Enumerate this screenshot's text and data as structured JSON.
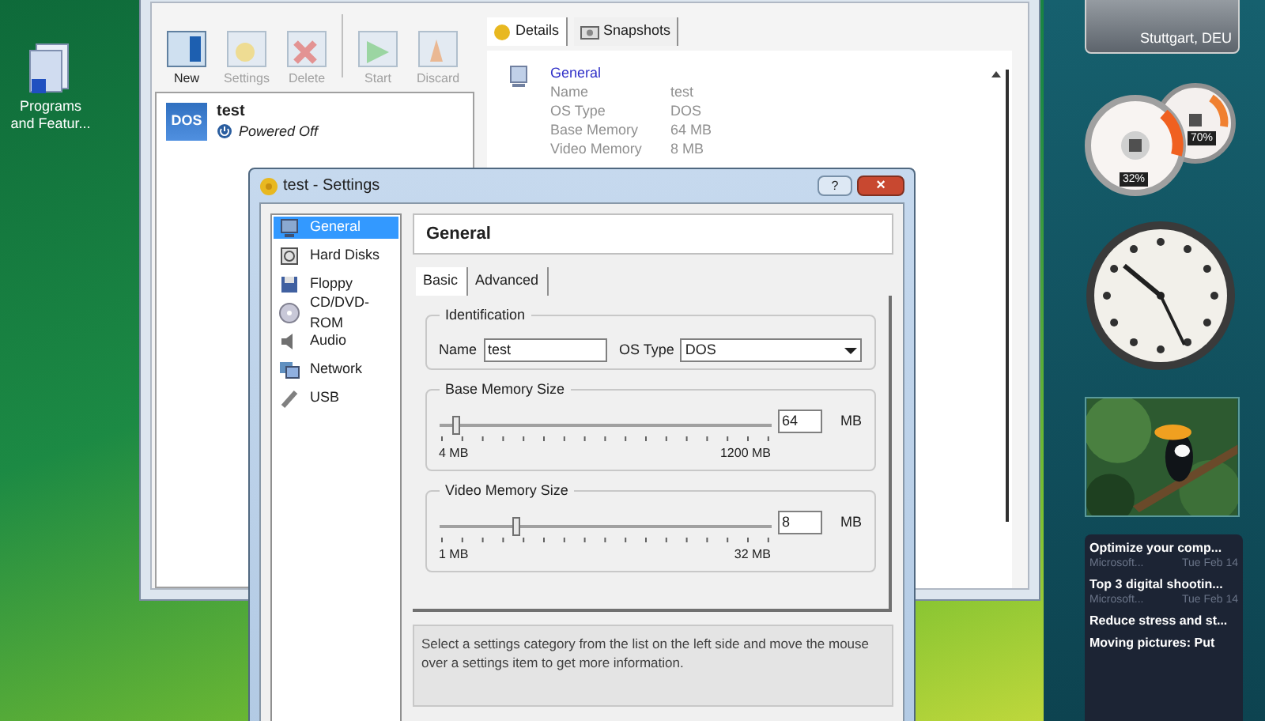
{
  "desktop_icons": [
    {
      "label": "Programs and Featur..."
    }
  ],
  "main_window": {
    "toolbar": [
      {
        "kind": "new",
        "label": "New",
        "disabled": false
      },
      {
        "kind": "settings",
        "label": "Settings",
        "disabled": true
      },
      {
        "kind": "delete",
        "label": "Delete",
        "disabled": true
      },
      {
        "kind": "start",
        "label": "Start",
        "disabled": true
      },
      {
        "kind": "discard",
        "label": "Discard",
        "disabled": true
      }
    ],
    "vms": [
      {
        "badge": "DOS",
        "name": "test",
        "state": "Powered Off",
        "selected": false
      }
    ],
    "detail_tabs": [
      {
        "kind": "details",
        "label": "Details",
        "selected": true
      },
      {
        "kind": "snapshots",
        "label": "Snapshots",
        "selected": false
      }
    ],
    "details": {
      "section": "General",
      "rows": [
        {
          "label": "Name",
          "value": "test"
        },
        {
          "label": "OS Type",
          "value": "DOS"
        },
        {
          "label": "Base Memory",
          "value": "64 MB"
        },
        {
          "label": "Video Memory",
          "value": "8 MB"
        }
      ]
    }
  },
  "settings_dialog": {
    "title": "test - Settings",
    "help": "?",
    "close": "×",
    "categories": [
      {
        "kind": "general",
        "label": "General",
        "selected": true
      },
      {
        "kind": "disk",
        "label": "Hard Disks",
        "selected": false
      },
      {
        "kind": "floppy",
        "label": "Floppy",
        "selected": false
      },
      {
        "kind": "cd",
        "label": "CD/DVD-ROM",
        "selected": false
      },
      {
        "kind": "audio",
        "label": "Audio",
        "selected": false
      },
      {
        "kind": "network",
        "label": "Network",
        "selected": false
      },
      {
        "kind": "usb",
        "label": "USB",
        "selected": false
      }
    ],
    "header": "General",
    "tabs": [
      {
        "label": "Basic",
        "selected": true
      },
      {
        "label": "Advanced",
        "selected": false
      }
    ],
    "identification": {
      "title": "Identification",
      "name_label": "Name",
      "name_value": "test",
      "os_label": "OS Type",
      "os_value": "DOS"
    },
    "memory": [
      {
        "title": "Base Memory Size",
        "level": 0.05,
        "value": "64",
        "unit": "MB",
        "min": "4 MB",
        "max": "1200 MB"
      },
      {
        "title": "Video Memory Size",
        "level": 0.23,
        "value": "8",
        "unit": "MB",
        "min": "1 MB",
        "max": "32 MB"
      }
    ],
    "info": "Select a settings category from the list on the left side and move the mouse over a settings item to get more information."
  },
  "gadgets": {
    "weather": {
      "location": "Stuttgart, DEU"
    },
    "meter": {
      "cpu": "32%",
      "memory": "70%"
    },
    "feed": [
      {
        "title": "Optimize your comp...",
        "source": "Microsoft...",
        "date": "Tue Feb 14"
      },
      {
        "title": "Top 3 digital shootin...",
        "source": "Microsoft...",
        "date": "Tue Feb 14"
      },
      {
        "title": "Reduce stress and st..."
      },
      {
        "title": "Moving pictures: Put"
      }
    ]
  }
}
